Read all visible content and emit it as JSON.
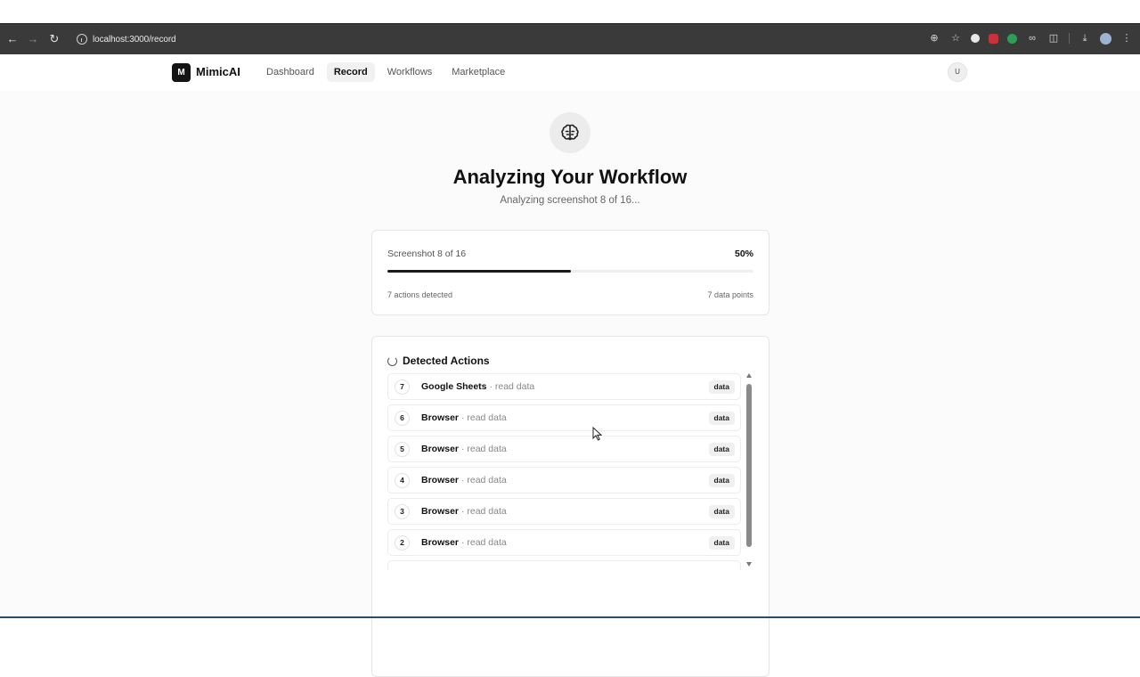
{
  "browser": {
    "url": "localhost:3000/record"
  },
  "app": {
    "logo_letter": "M",
    "name": "MimicAI",
    "nav": [
      {
        "label": "Dashboard",
        "active": false
      },
      {
        "label": "Record",
        "active": true
      },
      {
        "label": "Workflows",
        "active": false
      },
      {
        "label": "Marketplace",
        "active": false
      }
    ],
    "avatar": "U"
  },
  "hero": {
    "icon": "brain-icon",
    "title": "Analyzing Your Workflow",
    "subtitle": "Analyzing screenshot 8 of 16..."
  },
  "progress": {
    "label": "Screenshot 8 of 16",
    "percent": "50%",
    "fraction": 0.5,
    "actions_detected": "7 actions detected",
    "data_points": "7 data points"
  },
  "detected": {
    "title": "Detected Actions",
    "items": [
      {
        "num": "7",
        "app": "Google Sheets",
        "action": "· read data",
        "tag": "data"
      },
      {
        "num": "6",
        "app": "Browser",
        "action": "· read data",
        "tag": "data"
      },
      {
        "num": "5",
        "app": "Browser",
        "action": "· read data",
        "tag": "data"
      },
      {
        "num": "4",
        "app": "Browser",
        "action": "· read data",
        "tag": "data"
      },
      {
        "num": "3",
        "app": "Browser",
        "action": "· read data",
        "tag": "data"
      },
      {
        "num": "2",
        "app": "Browser",
        "action": "· read data",
        "tag": "data"
      }
    ]
  },
  "colors": {
    "accent": "#1a1a1a",
    "chrome": "#3a3a3a",
    "page_bg": "#fbfbfb"
  }
}
